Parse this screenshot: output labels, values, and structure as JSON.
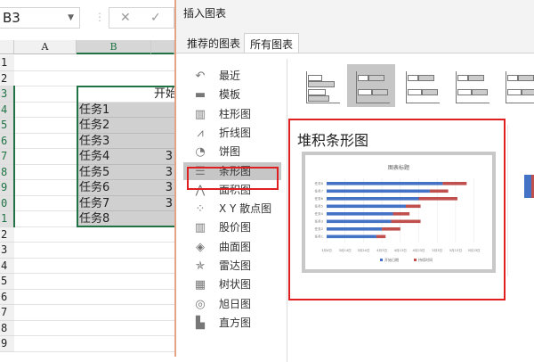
{
  "excel": {
    "name_box": "B3",
    "cancel": "✕",
    "confirm": "✓",
    "columns": [
      "A",
      "B"
    ],
    "rows": [
      "1",
      "2",
      "3",
      "4",
      "5",
      "6",
      "7",
      "8",
      "9",
      "0",
      "1",
      "2",
      "3",
      "4",
      "5",
      "6",
      "7",
      "8",
      "9"
    ],
    "header_partial": "开始",
    "tasks": [
      "任务1",
      "任务2",
      "任务3",
      "任务4",
      "任务5",
      "任务6",
      "任务7",
      "任务8"
    ],
    "col_c_partial": [
      "",
      "",
      "",
      "3",
      "3",
      "3",
      "3",
      ""
    ]
  },
  "dialog": {
    "title": "插入图表",
    "tabs": [
      "推荐的图表",
      "所有图表"
    ],
    "chart_types": [
      {
        "icon": "↶",
        "label": "最近"
      },
      {
        "icon": "▬",
        "label": "模板"
      },
      {
        "icon": "▥",
        "label": "柱形图"
      },
      {
        "icon": "⩘",
        "label": "折线图"
      },
      {
        "icon": "◔",
        "label": "饼图"
      },
      {
        "icon": "☰",
        "label": "条形图"
      },
      {
        "icon": "⋀",
        "label": "面积图"
      },
      {
        "icon": "⁘",
        "label": "X Y 散点图"
      },
      {
        "icon": "▥",
        "label": "股价图"
      },
      {
        "icon": "◈",
        "label": "曲面图"
      },
      {
        "icon": "✯",
        "label": "雷达图"
      },
      {
        "icon": "▦",
        "label": "树状图"
      },
      {
        "icon": "◎",
        "label": "旭日图"
      },
      {
        "icon": "▙",
        "label": "直方图"
      }
    ],
    "selected_type": "条形图",
    "subtype_title": "堆积条形图",
    "accent": "#e02020"
  },
  "chart_data": {
    "type": "bar",
    "orientation": "horizontal",
    "stacked": true,
    "title": "图表标题",
    "categories": [
      "任务1",
      "任务2",
      "任务3",
      "任务4",
      "任务5",
      "任务6",
      "任务7",
      "任务8"
    ],
    "series": [
      {
        "name": "开始日期",
        "color": "#4472c4",
        "values": [
          "3月31日",
          "4月3日",
          "4月8日",
          "4月9日",
          "4月16日",
          "4月23日",
          "4月29日",
          "5月6日"
        ]
      },
      {
        "name": "持续时间",
        "color": "#c0504d",
        "values": [
          5,
          10,
          16,
          9,
          8,
          21,
          10,
          13
        ]
      }
    ],
    "xticks": [
      "3月4日",
      "3月14日",
      "3月24日",
      "4月3日",
      "4月13日",
      "4月23日",
      "5月3日",
      "5月13日",
      "5月23日"
    ],
    "legend": "bottom",
    "grid": true
  }
}
